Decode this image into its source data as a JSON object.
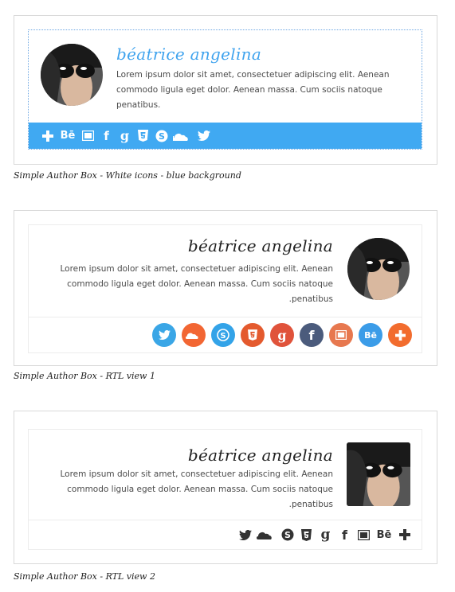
{
  "author": {
    "name": "béatrice angelina",
    "description": "Lorem ipsum dolor sit amet, consectetuer adipiscing elit. Aenean commodo ligula eget dolor. Aenean massa. Cum sociis natoque penatibus.",
    "description_rtl": "Lorem ipsum dolor sit amet, consectetuer adipiscing elit. Aenean commodo ligula eget dolor. Aenean massa. Cum sociis natoque penatibus."
  },
  "example1": {
    "caption": "Simple Author Box - White icons - blue background",
    "name_color": "#3fa3ee",
    "bar_color": "#40a9f2",
    "icons": [
      {
        "name": "add-icon",
        "glyph": "+"
      },
      {
        "name": "behance-icon",
        "glyph": "Bē"
      },
      {
        "name": "slideshare-icon",
        "glyph": ""
      },
      {
        "name": "facebook-icon",
        "glyph": "f"
      },
      {
        "name": "googleplus-icon",
        "glyph": "g"
      },
      {
        "name": "html5-icon",
        "glyph": "5"
      },
      {
        "name": "skype-icon",
        "glyph": "S"
      },
      {
        "name": "soundcloud-icon",
        "glyph": ""
      },
      {
        "name": "twitter-icon",
        "glyph": ""
      }
    ]
  },
  "example2": {
    "caption": "Simple Author Box - RTL view 1",
    "name_color": "#222222",
    "icons": [
      {
        "name": "twitter-icon",
        "glyph": "",
        "color": "#3aa6e6"
      },
      {
        "name": "soundcloud-icon",
        "glyph": "",
        "color": "#f26633"
      },
      {
        "name": "skype-icon",
        "glyph": "S",
        "color": "#33a3e8"
      },
      {
        "name": "html5-icon",
        "glyph": "5",
        "color": "#e45a2e"
      },
      {
        "name": "googleplus-icon",
        "glyph": "g",
        "color": "#e0533b"
      },
      {
        "name": "facebook-icon",
        "glyph": "f",
        "color": "#4b5b7c"
      },
      {
        "name": "slideshare-icon",
        "glyph": "",
        "color": "#e7784f"
      },
      {
        "name": "behance-icon",
        "glyph": "Bē",
        "color": "#3b9ce8"
      },
      {
        "name": "add-icon",
        "glyph": "+",
        "color": "#f26c2e"
      }
    ]
  },
  "example3": {
    "caption": "Simple Author Box - RTL view 2",
    "name_color": "#222222",
    "icons": [
      {
        "name": "twitter-icon",
        "glyph": ""
      },
      {
        "name": "soundcloud-icon",
        "glyph": ""
      },
      {
        "name": "skype-icon",
        "glyph": "S"
      },
      {
        "name": "html5-icon",
        "glyph": "5"
      },
      {
        "name": "googleplus-icon",
        "glyph": "g"
      },
      {
        "name": "facebook-icon",
        "glyph": "f"
      },
      {
        "name": "slideshare-icon",
        "glyph": ""
      },
      {
        "name": "behance-icon",
        "glyph": "Bē"
      },
      {
        "name": "add-icon",
        "glyph": "+"
      }
    ]
  }
}
